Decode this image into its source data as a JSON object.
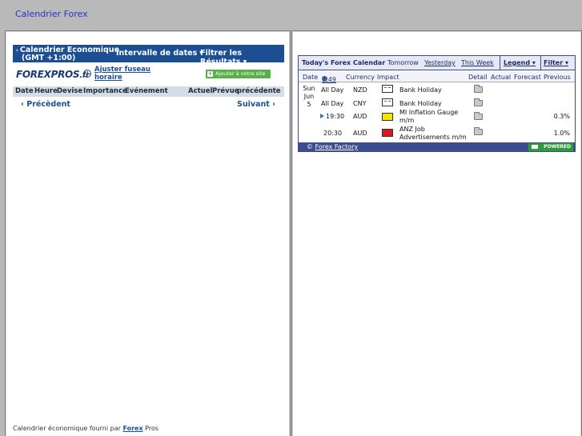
{
  "header": {
    "title": "Calendrier Forex"
  },
  "forexpros": {
    "bar": {
      "calendar_line1": "Calendrier Economique",
      "calendar_line2": "(GMT +1:00)",
      "dates": "Intervalle de dates",
      "filter": "Filtrer les Résultats"
    },
    "logo_main": "FOREXPROS",
    "logo_suffix": ".fr",
    "adjust_timezone": "Ajuster fuseau horaire",
    "add_to_site": "Ajouter à votre site",
    "columns": {
      "date": "Date",
      "time": "Heure",
      "currency": "Devise",
      "importance": "Importance",
      "event": "Evénement",
      "actual": "Actuel",
      "forecast": "Prévue",
      "previous": "précédente"
    },
    "prev": "Précèdent",
    "next": "Suivant",
    "footer_text": "Calendrier économique fourni par",
    "footer_link1": "Forex",
    "footer_link2": "Pros"
  },
  "forexfactory": {
    "title": "Today's Forex Calendar",
    "tomorrow": "Tomorrow",
    "yesterday": "Yesterday",
    "this_week": "This Week",
    "legend": "Legend",
    "filter": "Filter",
    "columns": {
      "date": "Date",
      "time": "7:49",
      "currency": "Currency",
      "impact": "Impact",
      "detail": "Detail",
      "actual": "Actual",
      "forecast": "Forecast",
      "previous": "Previous"
    },
    "date_day": "Sun",
    "date_mon": "Jun 5",
    "rows": [
      {
        "time": "All Day",
        "currency": "NZD",
        "impact": "white",
        "event": "Bank Holiday",
        "previous": ""
      },
      {
        "time": "All Day",
        "currency": "CNY",
        "impact": "white",
        "event": "Bank Holiday",
        "previous": ""
      },
      {
        "time": "19:30",
        "currency": "AUD",
        "impact": "yellow",
        "event": "MI Inflation Gauge m/m",
        "previous": "0.3%"
      },
      {
        "time": "20:30",
        "currency": "AUD",
        "impact": "red",
        "event": "ANZ Job Advertisements m/m",
        "previous": "1.0%"
      }
    ],
    "copyright": "©",
    "copyright_link": "Forex Factory",
    "powered": "POWERED"
  }
}
